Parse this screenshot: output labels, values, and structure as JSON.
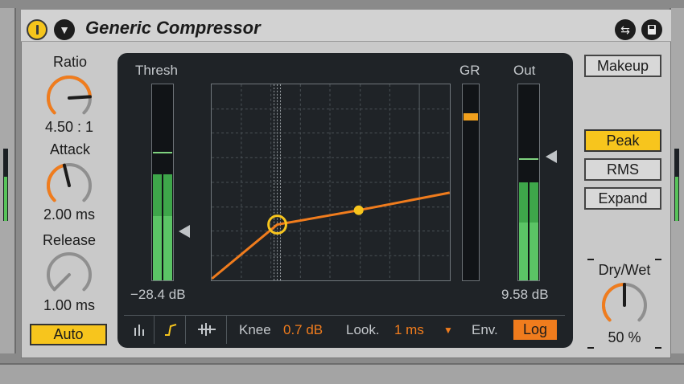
{
  "device": {
    "title": "Generic Compressor",
    "power_icon": "power-icon",
    "fold_icon": "triangle-down-icon",
    "hotswap_icon": "hotswap-icon",
    "save_icon": "save-icon"
  },
  "controls": {
    "ratio": {
      "label": "Ratio",
      "value": "4.50 : 1",
      "level": 0.82
    },
    "attack": {
      "label": "Attack",
      "value": "2.00 ms",
      "level": 0.45
    },
    "release": {
      "label": "Release",
      "value": "1.00 ms",
      "level": 0.0
    },
    "auto_label": "Auto",
    "makeup_label": "Makeup",
    "peak_label": "Peak",
    "rms_label": "RMS",
    "expand_label": "Expand",
    "drywet": {
      "label": "Dry/Wet",
      "value": "50 %",
      "level": 0.5
    }
  },
  "display": {
    "thresh_label": "Thresh",
    "thresh_value": "−28.4 dB",
    "gr_label": "GR",
    "out_label": "Out",
    "out_value": "9.58 dB",
    "knee_label": "Knee",
    "knee_value": "0.7 dB",
    "look_label": "Look.",
    "look_value": "1 ms",
    "env_label": "Env.",
    "env_value": "Log",
    "tool_icons": [
      "bar-meter-icon",
      "curve-icon",
      "waveform-icon"
    ],
    "dropdown_icon": "triangle-down-icon"
  },
  "colors": {
    "accent_yellow": "#f7c51d",
    "accent_orange": "#f07c1d",
    "meter_green": "#3ea64a",
    "display_bg": "#1f2327"
  }
}
